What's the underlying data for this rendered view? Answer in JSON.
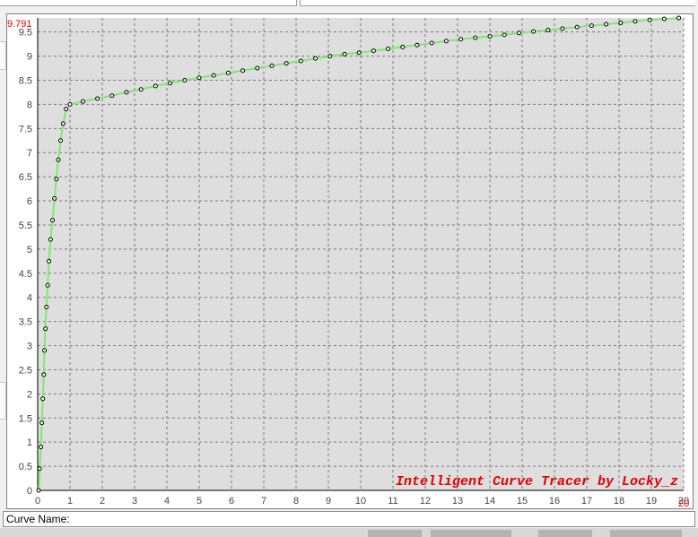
{
  "status": {
    "curve_name_label": "Curve Name:"
  },
  "colors": {
    "plot_bg": "#dedede",
    "grid": "#7a7a7a",
    "curve": "#7cea6c",
    "markers": "#000000",
    "watermark": "#e00000",
    "axis_text": "#444444",
    "range_text": "#e00000"
  },
  "chart_data": {
    "type": "line",
    "title": "",
    "xlabel": "",
    "ylabel": "",
    "xlim": [
      0,
      20
    ],
    "ylim": [
      0,
      9.791
    ],
    "x_ticks": [
      "0",
      "1",
      "2",
      "3",
      "4",
      "5",
      "6",
      "7",
      "8",
      "9",
      "10",
      "11",
      "12",
      "13",
      "14",
      "15",
      "16",
      "17",
      "18",
      "19",
      "20"
    ],
    "y_ticks": [
      "0",
      "0.5",
      "1",
      "1.5",
      "2",
      "2.5",
      "3",
      "3.5",
      "4",
      "4.5",
      "5",
      "5.5",
      "6",
      "6.5",
      "7",
      "7.5",
      "8",
      "8.5",
      "9",
      "9.5"
    ],
    "y_max_label": "9.791",
    "x_max_label": "20",
    "grid": true,
    "watermark": "Intelligent Curve Tracer by Locky_z",
    "series": [
      {
        "marker": "circle",
        "x": [
          0.03,
          0.06,
          0.1,
          0.13,
          0.16,
          0.19,
          0.21,
          0.24,
          0.27,
          0.31,
          0.35,
          0.4,
          0.46,
          0.52,
          0.58,
          0.64,
          0.71,
          0.79,
          0.88,
          1.0,
          1.4,
          1.85,
          2.3,
          2.75,
          3.2,
          3.65,
          4.1,
          4.55,
          5.0,
          5.45,
          5.9,
          6.35,
          6.8,
          7.25,
          7.7,
          8.15,
          8.6,
          9.05,
          9.5,
          9.95,
          10.4,
          10.85,
          11.3,
          11.75,
          12.2,
          12.65,
          13.1,
          13.55,
          14.0,
          14.45,
          14.9,
          15.35,
          15.8,
          16.25,
          16.7,
          17.15,
          17.6,
          18.05,
          18.5,
          18.95,
          19.4,
          19.85
        ],
        "y": [
          0.0,
          0.45,
          0.9,
          1.4,
          1.9,
          2.4,
          2.9,
          3.35,
          3.8,
          4.25,
          4.75,
          5.2,
          5.6,
          6.05,
          6.45,
          6.85,
          7.25,
          7.6,
          7.9,
          8.0,
          8.06,
          8.12,
          8.18,
          8.25,
          8.31,
          8.38,
          8.44,
          8.5,
          8.55,
          8.6,
          8.65,
          8.7,
          8.75,
          8.8,
          8.85,
          8.9,
          8.95,
          9.0,
          9.04,
          9.07,
          9.11,
          9.15,
          9.19,
          9.23,
          9.27,
          9.31,
          9.35,
          9.38,
          9.41,
          9.44,
          9.48,
          9.51,
          9.54,
          9.57,
          9.6,
          9.63,
          9.66,
          9.69,
          9.72,
          9.75,
          9.77,
          9.79
        ]
      }
    ]
  }
}
